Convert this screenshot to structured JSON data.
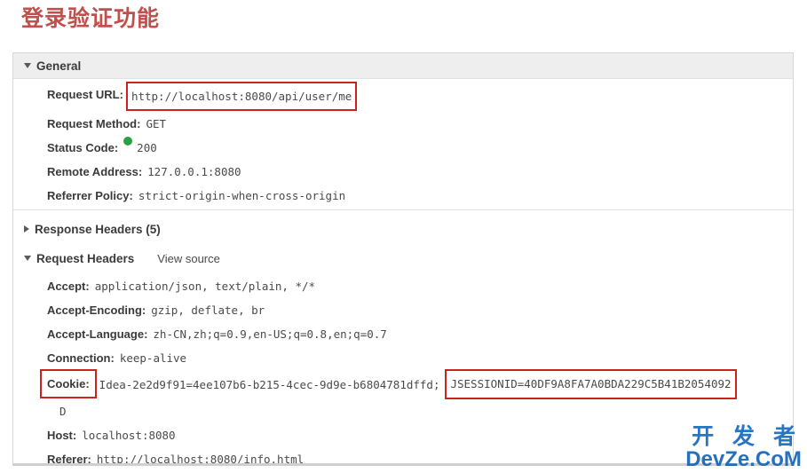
{
  "page": {
    "title": "登录验证功能"
  },
  "devtools": {
    "general": {
      "label": "General",
      "toggle_icon": "triangle-down-icon",
      "rows": [
        {
          "key": "Request URL:",
          "value": "http://localhost:8080/api/user/me",
          "highlight": true
        },
        {
          "key": "Request Method:",
          "value": "GET",
          "highlight": false
        },
        {
          "key": "Status Code:",
          "value": "200",
          "status_dot": true,
          "status_color": "#2ea043",
          "highlight": false
        },
        {
          "key": "Remote Address:",
          "value": "127.0.0.1:8080",
          "highlight": false
        },
        {
          "key": "Referrer Policy:",
          "value": "strict-origin-when-cross-origin",
          "highlight": false
        }
      ]
    },
    "response_headers": {
      "label": "Response Headers (5)",
      "toggle_icon": "triangle-right-icon",
      "expanded": false
    },
    "request_headers": {
      "label": "Request Headers",
      "view_source_label": "View source",
      "toggle_icon": "triangle-down-icon",
      "expanded": true,
      "rows": [
        {
          "key": "Accept:",
          "value": "application/json, text/plain, */*"
        },
        {
          "key": "Accept-Encoding:",
          "value": "gzip, deflate, br"
        },
        {
          "key": "Accept-Language:",
          "value": "zh-CN,zh;q=0.9,en-US;q=0.8,en;q=0.7"
        },
        {
          "key": "Connection:",
          "value": "keep-alive"
        }
      ],
      "cookie": {
        "key": "Cookie:",
        "value_first": "Idea-2e2d9f91=4ee107b6-b215-4cec-9d9e-b6804781dffd;",
        "value_session": "JSESSIONID=40DF9A8FA7A0BDA229C5B41B2054092",
        "value_wrap": "D",
        "key_highlight": true,
        "session_highlight": true
      },
      "rows_after": [
        {
          "key": "Host:",
          "value": "localhost:8080"
        },
        {
          "key": "Referer:",
          "value": "http://localhost:8080/info.html"
        }
      ]
    },
    "highlight_color": "#cc2222"
  },
  "watermark": {
    "cn": "开 发 者",
    "en": "DevZe.CoM"
  }
}
